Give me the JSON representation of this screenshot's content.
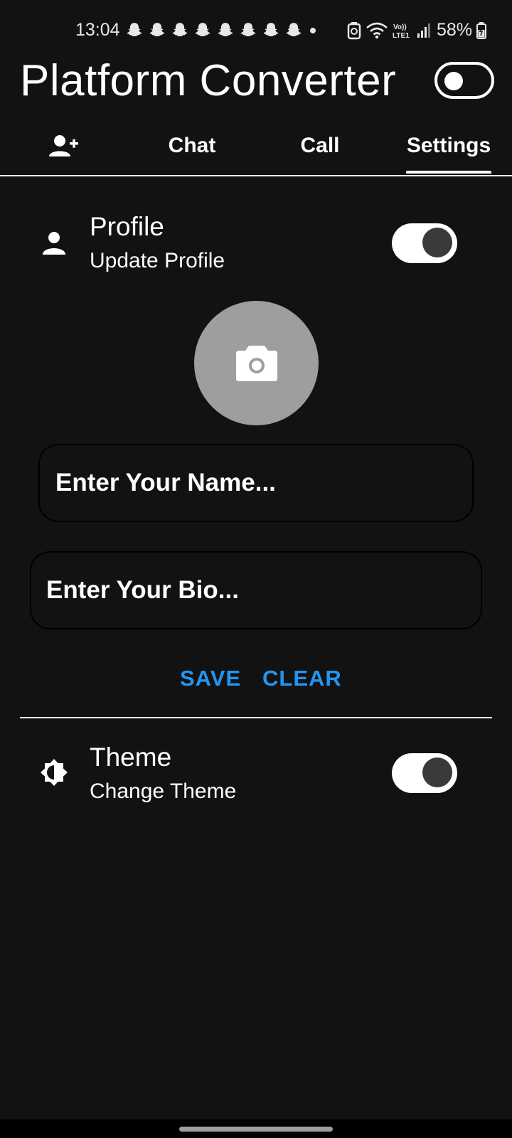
{
  "status_bar": {
    "time": "13:04",
    "notification_icons": [
      "snapchat-icon",
      "snapchat-icon",
      "snapchat-icon",
      "snapchat-icon",
      "snapchat-icon",
      "snapchat-icon",
      "snapchat-icon",
      "snapchat-icon"
    ],
    "network_label": "Vo) LTE1",
    "battery": "58%"
  },
  "app_bar": {
    "title": "Platform Converter",
    "dark_mode_toggle_on": false
  },
  "tabs": [
    {
      "label": "",
      "icon": "person-add-icon",
      "selected": false
    },
    {
      "label": "Chat",
      "selected": false
    },
    {
      "label": "Call",
      "selected": false
    },
    {
      "label": "Settings",
      "selected": true
    }
  ],
  "profile_section": {
    "icon": "person-icon",
    "title": "Profile",
    "subtitle": "Update Profile",
    "switch_on": true,
    "avatar_icon": "camera-icon",
    "name_placeholder": "Enter Your Name...",
    "bio_placeholder": "Enter Your Bio...",
    "save_label": "SAVE",
    "clear_label": "CLEAR"
  },
  "theme_section": {
    "icon": "brightness-icon",
    "title": "Theme",
    "subtitle": "Change Theme",
    "switch_on": true
  },
  "colors": {
    "background": "#121212",
    "accent": "#2196f3",
    "avatar": "#9e9e9e"
  }
}
